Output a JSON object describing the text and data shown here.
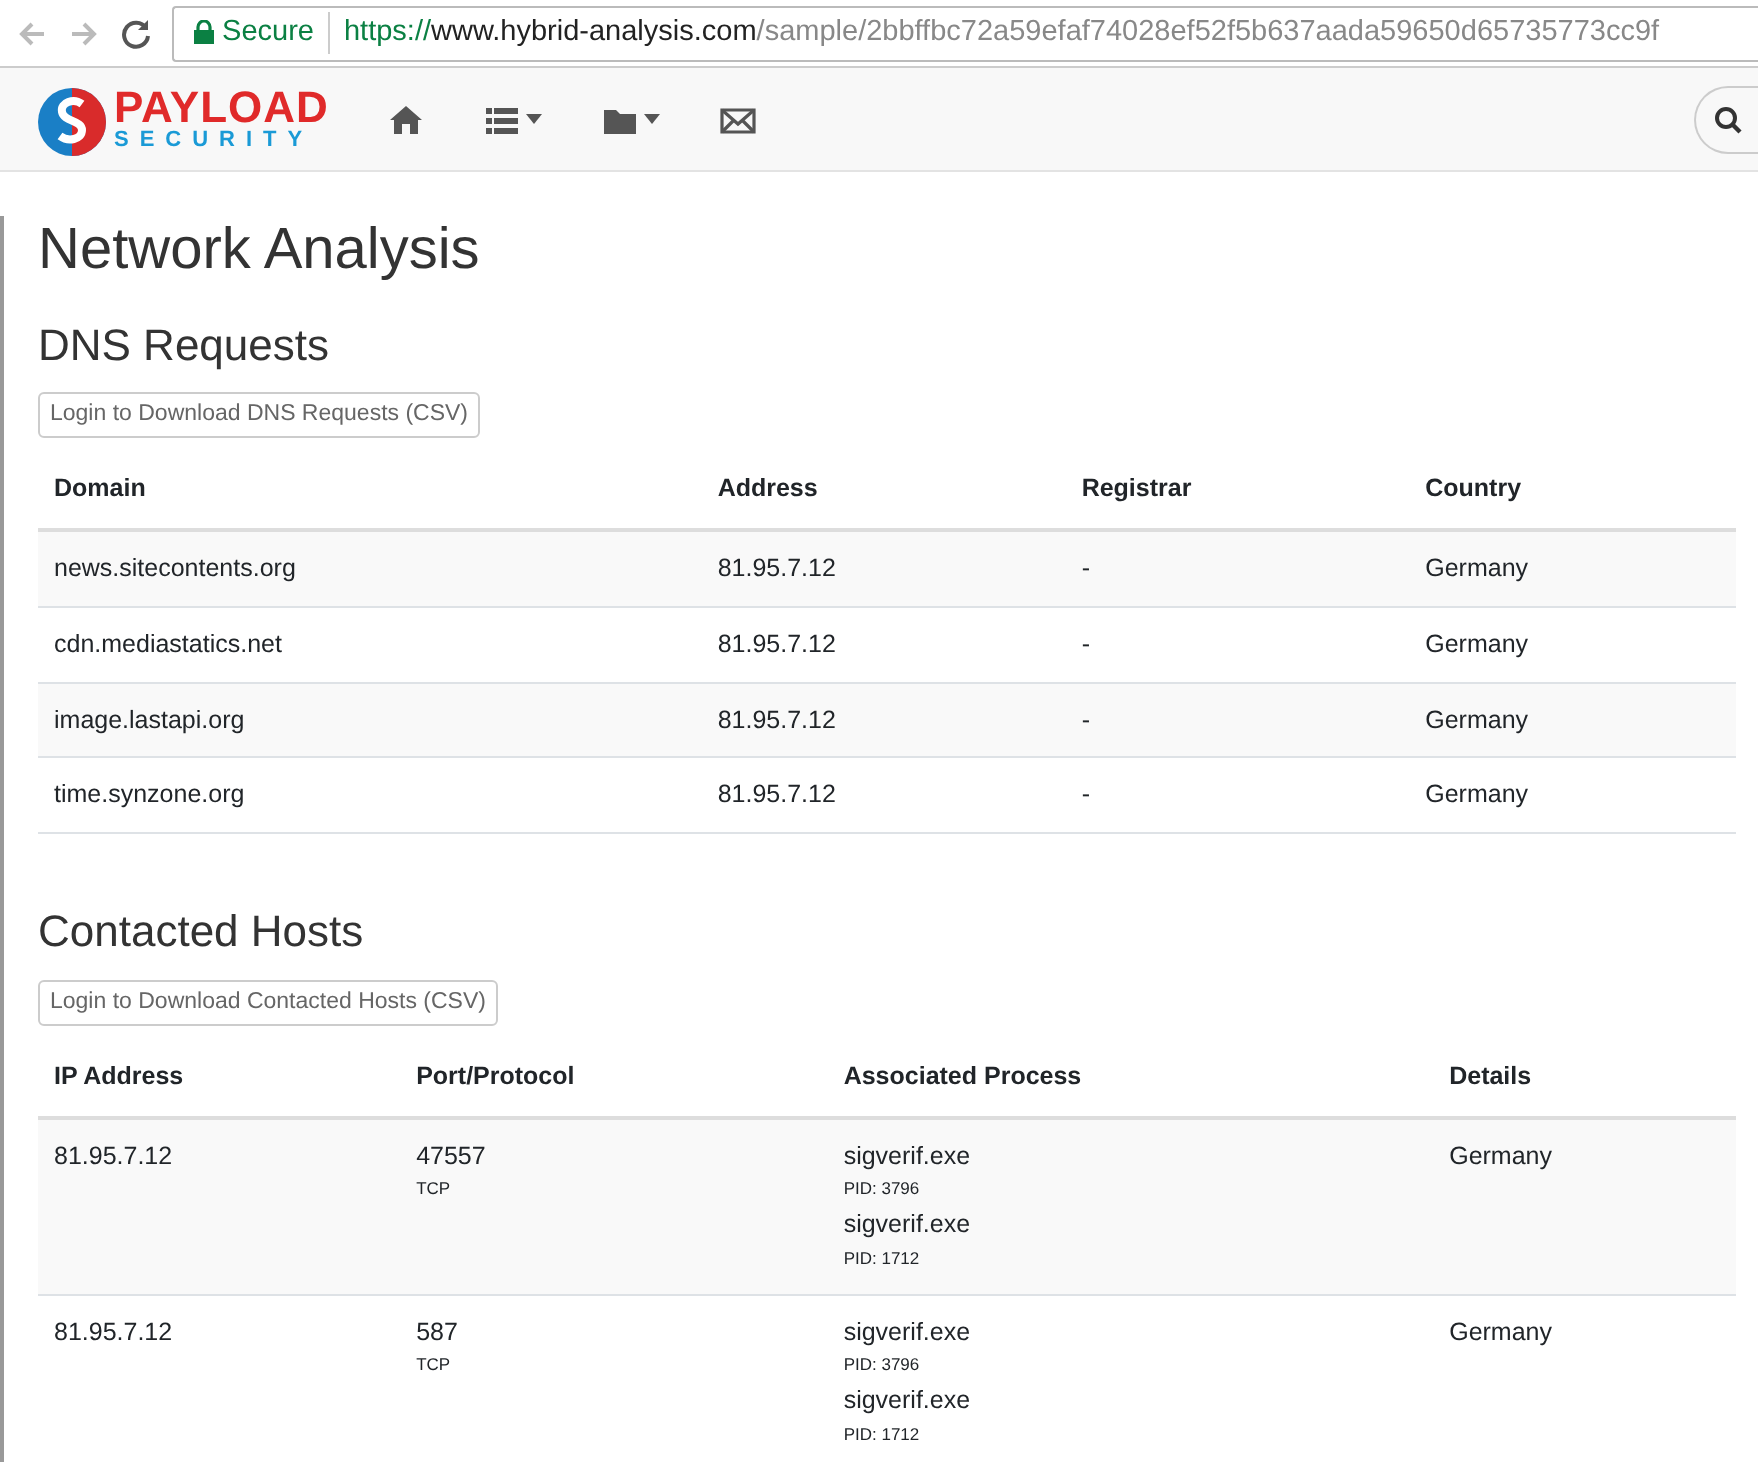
{
  "browser": {
    "secure_label": "Secure",
    "url_scheme": "https://",
    "url_host": "www.hybrid-analysis.com",
    "url_path": "/sample/2bbffbc72a59efaf74028ef52f5b637aada59650d65735773cc9f"
  },
  "navbar": {
    "logo_top": "PAYLOAD",
    "logo_bottom": "SECURITY",
    "items": [
      {
        "kind": "home"
      },
      {
        "kind": "list",
        "dropdown": true
      },
      {
        "kind": "folder",
        "dropdown": true
      },
      {
        "kind": "mail",
        "dropdown": false
      }
    ]
  },
  "page_title": "Network Analysis",
  "dns": {
    "title": "DNS Requests",
    "download_button": "Login to Download DNS Requests (CSV)",
    "columns": [
      "Domain",
      "Address",
      "Registrar",
      "Country"
    ],
    "rows": [
      {
        "domain": "news.sitecontents.org",
        "address": "81.95.7.12",
        "registrar": "-",
        "country": "Germany"
      },
      {
        "domain": "cdn.mediastatics.net",
        "address": "81.95.7.12",
        "registrar": "-",
        "country": "Germany"
      },
      {
        "domain": "image.lastapi.org",
        "address": "81.95.7.12",
        "registrar": "-",
        "country": "Germany"
      },
      {
        "domain": "time.synzone.org",
        "address": "81.95.7.12",
        "registrar": "-",
        "country": "Germany"
      }
    ]
  },
  "hosts": {
    "title": "Contacted Hosts",
    "download_button": "Login to Download Contacted Hosts (CSV)",
    "columns": [
      "IP Address",
      "Port/Protocol",
      "Associated Process",
      "Details"
    ],
    "rows": [
      {
        "ip": "81.95.7.12",
        "port": "47557",
        "protocol": "TCP",
        "processes": [
          {
            "name": "sigverif.exe",
            "pid": "PID: 3796"
          },
          {
            "name": "sigverif.exe",
            "pid": "PID: 1712"
          }
        ],
        "details": "Germany"
      },
      {
        "ip": "81.95.7.12",
        "port": "587",
        "protocol": "TCP",
        "processes": [
          {
            "name": "sigverif.exe",
            "pid": "PID: 3796"
          },
          {
            "name": "sigverif.exe",
            "pid": "PID: 1712"
          }
        ],
        "details": "Germany"
      }
    ]
  }
}
